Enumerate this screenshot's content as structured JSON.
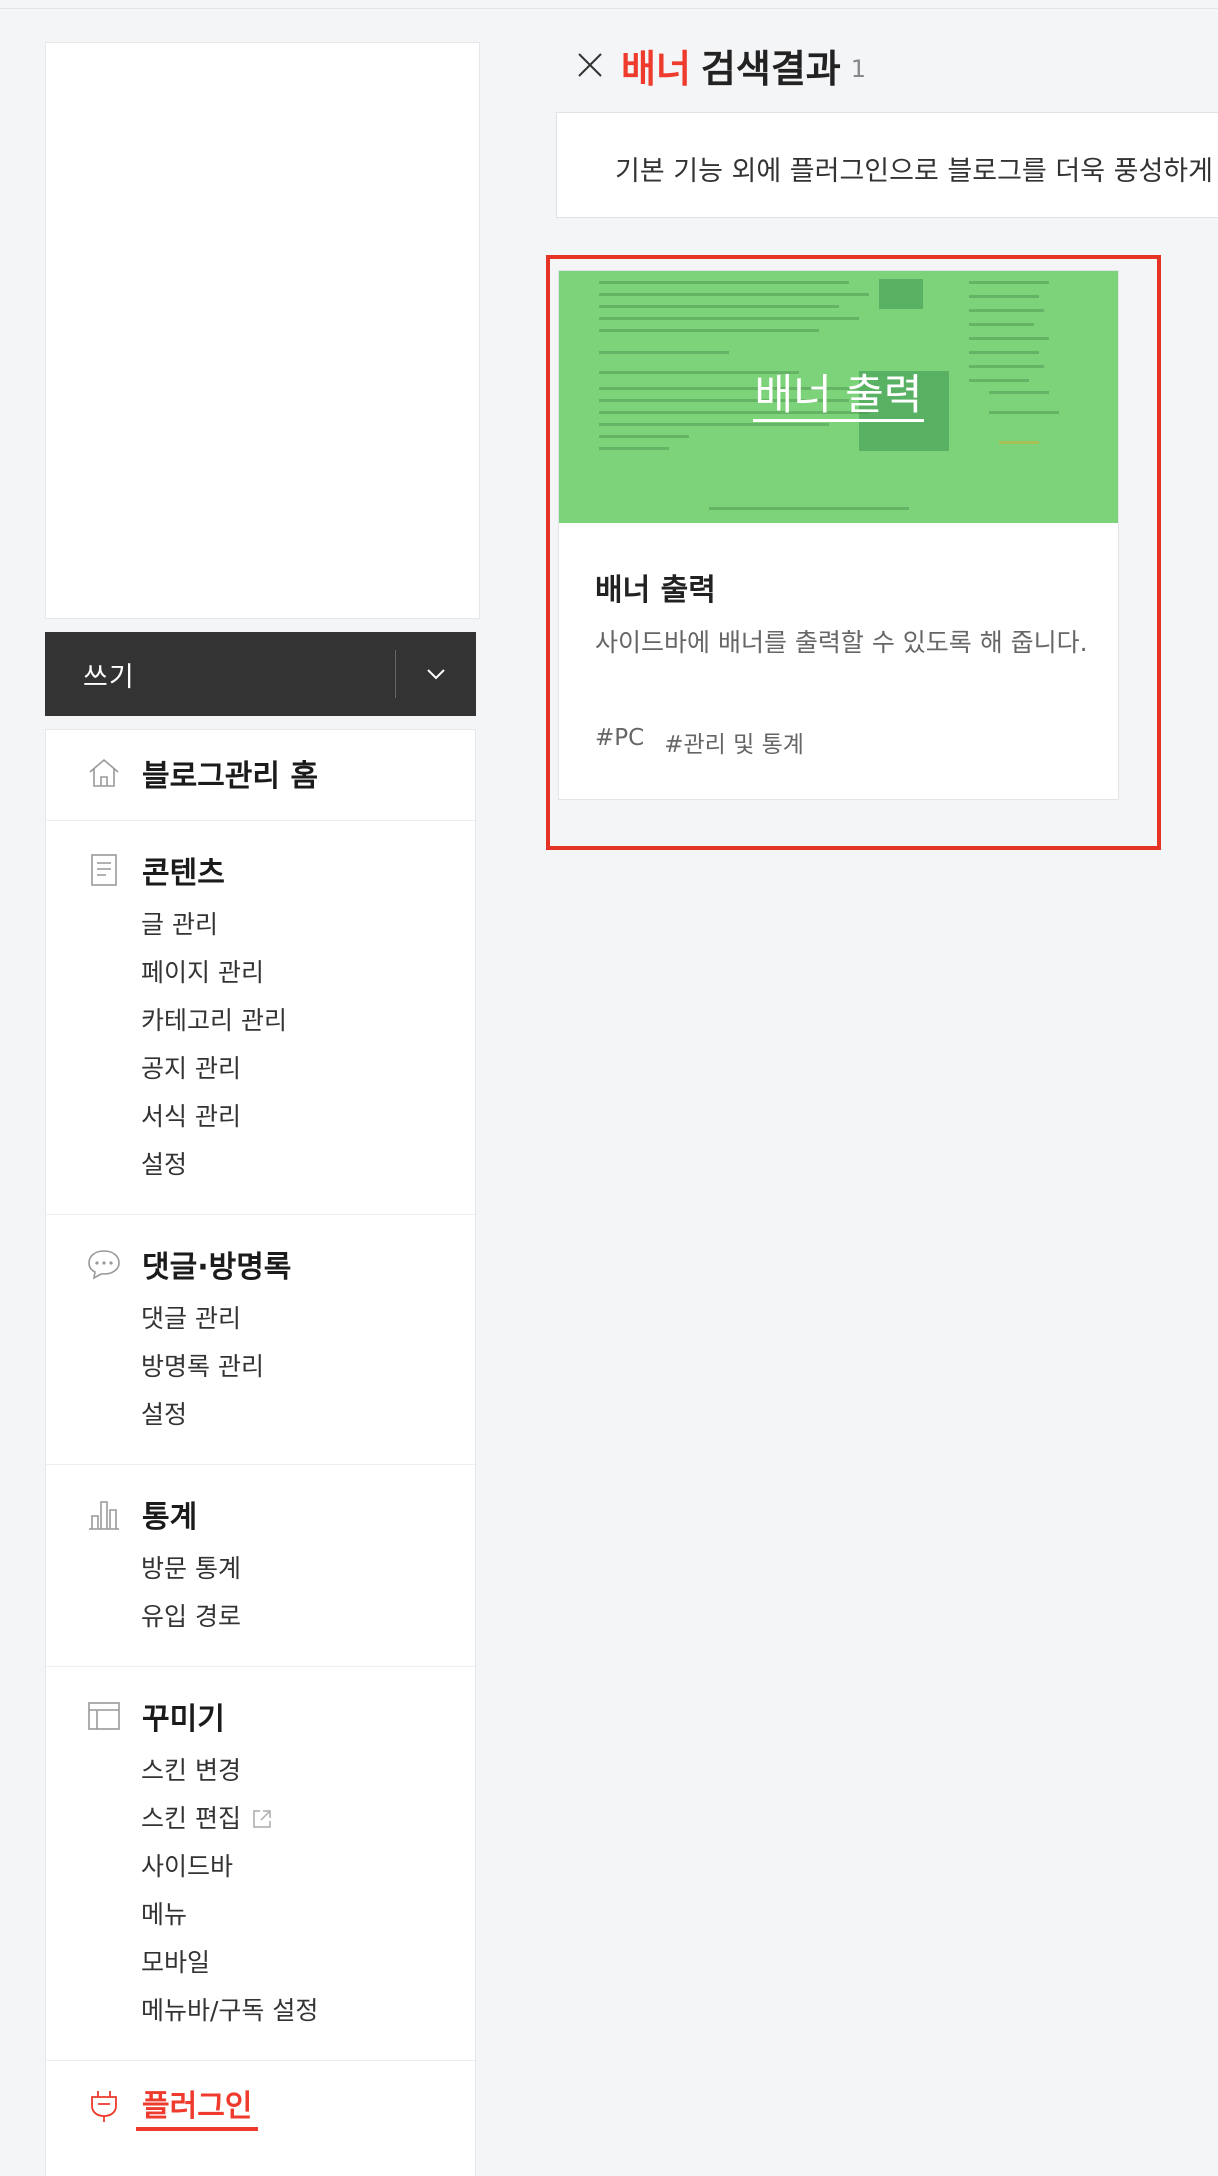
{
  "sidebar": {
    "write_button": {
      "label": "쓰기"
    },
    "sections": [
      {
        "icon": "home-icon",
        "title": "블로그관리 홈",
        "items": []
      },
      {
        "icon": "document-icon",
        "title": "콘텐츠",
        "items": [
          "글 관리",
          "페이지 관리",
          "카테고리 관리",
          "공지 관리",
          "서식 관리",
          "설정"
        ]
      },
      {
        "icon": "comment-icon",
        "title": "댓글·방명록",
        "items": [
          "댓글 관리",
          "방명록 관리",
          "설정"
        ]
      },
      {
        "icon": "chart-icon",
        "title": "통계",
        "items": [
          "방문 통계",
          "유입 경로"
        ]
      },
      {
        "icon": "layout-icon",
        "title": "꾸미기",
        "items": [
          "스킨 변경",
          "스킨 편집",
          "사이드바",
          "메뉴",
          "모바일",
          "메뉴바/구독 설정"
        ]
      },
      {
        "icon": "plug-icon",
        "title": "플러그인",
        "items": []
      }
    ]
  },
  "search": {
    "keyword": "배너",
    "result_label": "검색결과",
    "count": "1"
  },
  "description": "기본 기능 외에 플러그인으로 블로그를 더욱 풍성하게 ",
  "result_card": {
    "thumbnail_title": "배너 출력",
    "title": "배너 출력",
    "description": "사이드바에 배너를 출력할 수 있도록 해 줍니다.",
    "tags": [
      "#PC",
      "#관리 및 통계"
    ]
  },
  "colors": {
    "accent": "#ee3b2d",
    "thumbnail_green": "#7cd37a",
    "highlight_border": "#e53425"
  }
}
